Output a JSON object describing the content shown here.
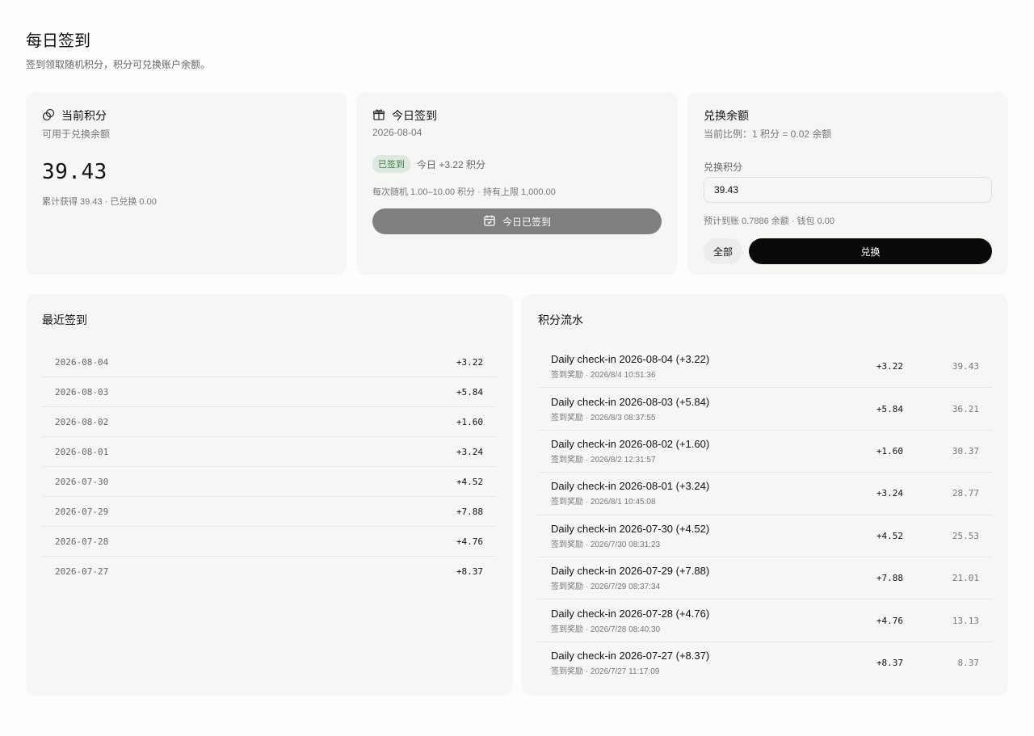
{
  "header": {
    "title": "每日签到",
    "subtitle": "签到领取随机积分，积分可兑换账户余额。"
  },
  "points_card": {
    "title": "当前积分",
    "desc": "可用于兑换余额",
    "value": "39.43",
    "meta": "累计获得 39.43 · 已兑换 0.00",
    "icon": "coins-icon"
  },
  "checkin_card": {
    "title": "今日签到",
    "date": "2026-08-04",
    "badge": "已签到",
    "today": "今日 +3.22 积分",
    "rule": "每次随机 1.00–10.00 积分 · 持有上限 1,000.00",
    "button": "今日已签到",
    "icon": "gift-icon"
  },
  "exchange_card": {
    "title": "兑换余额",
    "ratio": "当前比例：1 积分 = 0.02 余额",
    "field_label": "兑换积分",
    "field_value": "39.43",
    "estimate": "预计到账 0.7886 余额 · 钱包 0.00",
    "all_button": "全部",
    "exchange_button": "兑换"
  },
  "recent": {
    "title": "最近签到",
    "rows": [
      {
        "date": "2026-08-04",
        "amount": "+3.22"
      },
      {
        "date": "2026-08-03",
        "amount": "+5.84"
      },
      {
        "date": "2026-08-02",
        "amount": "+1.60"
      },
      {
        "date": "2026-08-01",
        "amount": "+3.24"
      },
      {
        "date": "2026-07-30",
        "amount": "+4.52"
      },
      {
        "date": "2026-07-29",
        "amount": "+7.88"
      },
      {
        "date": "2026-07-28",
        "amount": "+4.76"
      },
      {
        "date": "2026-07-27",
        "amount": "+8.37"
      }
    ]
  },
  "ledger": {
    "title": "积分流水",
    "rows": [
      {
        "title": "Daily check-in 2026-08-04 (+3.22)",
        "sub": "签到奖励 · 2026/8/4 10:51:36",
        "amount": "+3.22",
        "balance": "39.43"
      },
      {
        "title": "Daily check-in 2026-08-03 (+5.84)",
        "sub": "签到奖励 · 2026/8/3 08:37:55",
        "amount": "+5.84",
        "balance": "36.21"
      },
      {
        "title": "Daily check-in 2026-08-02 (+1.60)",
        "sub": "签到奖励 · 2026/8/2 12:31:57",
        "amount": "+1.60",
        "balance": "30.37"
      },
      {
        "title": "Daily check-in 2026-08-01 (+3.24)",
        "sub": "签到奖励 · 2026/8/1 10:45:08",
        "amount": "+3.24",
        "balance": "28.77"
      },
      {
        "title": "Daily check-in 2026-07-30 (+4.52)",
        "sub": "签到奖励 · 2026/7/30 08:31:23",
        "amount": "+4.52",
        "balance": "25.53"
      },
      {
        "title": "Daily check-in 2026-07-29 (+7.88)",
        "sub": "签到奖励 · 2026/7/29 08:37:34",
        "amount": "+7.88",
        "balance": "21.01"
      },
      {
        "title": "Daily check-in 2026-07-28 (+4.76)",
        "sub": "签到奖励 · 2026/7/28 08:40:30",
        "amount": "+4.76",
        "balance": "13.13"
      },
      {
        "title": "Daily check-in 2026-07-27 (+8.37)",
        "sub": "签到奖励 · 2026/7/27 11:17:09",
        "amount": "+8.37",
        "balance": "8.37"
      }
    ]
  }
}
